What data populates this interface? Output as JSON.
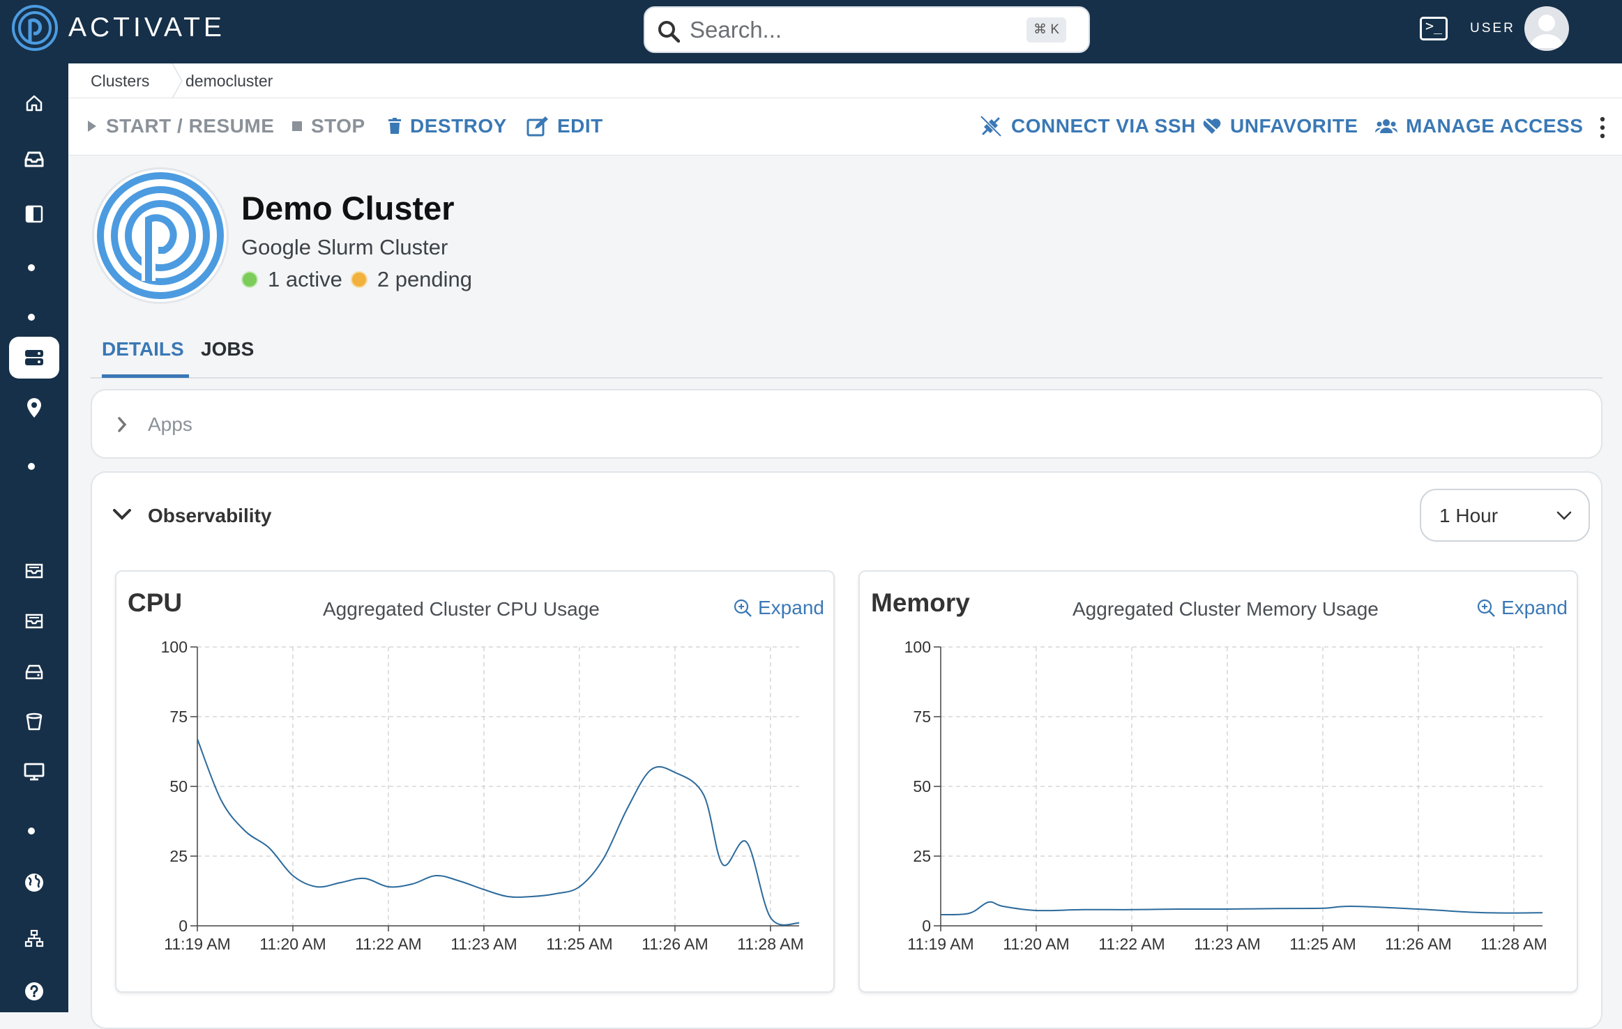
{
  "app": {
    "brand": "ACTIVATE",
    "user_label": "USER"
  },
  "search": {
    "placeholder": "Search...",
    "shortcut": "⌘ K"
  },
  "breadcrumb": [
    "Clusters",
    "democluster"
  ],
  "toolbar": {
    "start": "START / RESUME",
    "stop": "STOP",
    "destroy": "DESTROY",
    "edit": "EDIT",
    "ssh": "CONNECT VIA SSH",
    "unfavorite": "UNFAVORITE",
    "manage": "MANAGE ACCESS"
  },
  "cluster": {
    "name": "Demo Cluster",
    "type": "Google Slurm Cluster",
    "active": "1 active",
    "pending": "2 pending"
  },
  "tabs": [
    {
      "label": "DETAILS",
      "active": true
    },
    {
      "label": "JOBS",
      "active": false
    }
  ],
  "sections": {
    "apps": "Apps",
    "observability": "Observability",
    "range": "1 Hour"
  },
  "colors": {
    "nav": "#163049",
    "accent": "#3a78b5",
    "active": "#7ccc5a",
    "pending": "#f2b13c"
  },
  "charts": {
    "cpu": {
      "heading": "CPU",
      "title": "Aggregated Cluster CPU Usage",
      "expand": "Expand"
    },
    "memory": {
      "heading": "Memory",
      "title": "Aggregated Cluster Memory Usage",
      "expand": "Expand"
    }
  },
  "chart_data": [
    {
      "type": "line",
      "title": "Aggregated Cluster CPU Usage",
      "xlabel": "",
      "ylabel": "",
      "ylim": [
        0,
        100
      ],
      "yticks": [
        0,
        25,
        50,
        75,
        100
      ],
      "xticks": [
        "11:19 AM",
        "11:20 AM",
        "11:22 AM",
        "11:23 AM",
        "11:25 AM",
        "11:26 AM",
        "11:28 AM"
      ],
      "grid": true,
      "series": [
        {
          "x": [
            0,
            0.25,
            0.5,
            0.75,
            1,
            1.25,
            1.5,
            1.75,
            2,
            2.25,
            2.5,
            2.75,
            3,
            3.25,
            3.5,
            3.75,
            4,
            4.25,
            4.5,
            4.75,
            5,
            5.3,
            5.5,
            5.75,
            6,
            6.3
          ],
          "y": [
            67,
            45,
            34,
            28,
            18,
            14,
            15.5,
            17,
            14,
            15,
            18,
            16,
            13,
            10.5,
            10.5,
            11.5,
            14,
            24,
            42,
            56,
            55,
            47,
            22,
            30,
            3,
            1
          ]
        }
      ]
    },
    {
      "type": "line",
      "title": "Aggregated Cluster Memory Usage",
      "xlabel": "",
      "ylabel": "",
      "ylim": [
        0,
        100
      ],
      "yticks": [
        0,
        25,
        50,
        75,
        100
      ],
      "xticks": [
        "11:19 AM",
        "11:20 AM",
        "11:22 AM",
        "11:23 AM",
        "11:25 AM",
        "11:26 AM",
        "11:28 AM"
      ],
      "grid": true,
      "series": [
        {
          "x": [
            0,
            0.3,
            0.5,
            0.65,
            1,
            1.5,
            2,
            2.5,
            3,
            3.5,
            4,
            4.3,
            5,
            5.6,
            6,
            6.3
          ],
          "y": [
            4,
            4.5,
            8.5,
            7,
            5.5,
            5.8,
            5.8,
            6,
            6,
            6.2,
            6.3,
            7,
            6,
            4.8,
            4.6,
            4.7
          ]
        }
      ]
    }
  ]
}
